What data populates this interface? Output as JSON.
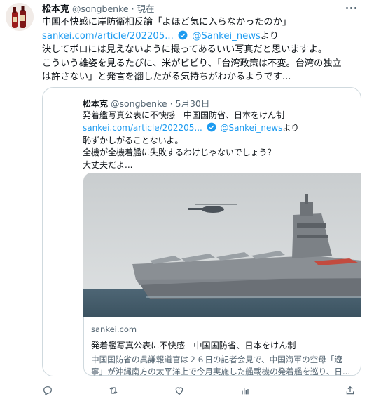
{
  "tweet": {
    "author_name": "松本克",
    "author_handle": "@songbenke",
    "time": "· 現在",
    "lines": [
      "中国不快感に岸防衛相反論「よほど気に入らなかったのか」",
      "決してボロには見えないように撮ってあるいい写真だと思いますよ。",
      "こういう雄姿を見るたびに、米がビビり、「台湾政策は不変。台湾の独立",
      "は許さない」と発言を翻したがる気持ちがわかるようです..."
    ],
    "link_text": "sankei.com/article/202205...",
    "mention": "@Sankei_news",
    "mention_suffix": "より"
  },
  "quote": {
    "author_name": "松本克",
    "author_handle": "@songbenke",
    "time": "· 5月30日",
    "lines": [
      "発着艦写真公表に不快感　中国国防省、日本をけん制",
      "恥ずかしがることないよ。",
      "全機が全機着艦に失敗するわけじゃないでしょう？",
      "大丈夫だよ..."
    ],
    "link_text": "sankei.com/article/202205...",
    "mention": "@Sankei_news",
    "mention_suffix": "より"
  },
  "link_card": {
    "domain": "sankei.com",
    "title": "発着艦写真公表に不快感　中国国防省、日本をけん制",
    "desc_lines": [
      "中国国防省の呉謙報道官は２６日の記者会見で、中国海軍の空母「遼",
      "寧」が沖縄南方の太平洋上で今月実施した艦載機の発着艦を巡り、日..."
    ]
  },
  "icons": [
    "more-icon",
    "verified-icon",
    "reply-icon",
    "retweet-icon",
    "like-icon",
    "analytics-icon",
    "share-icon"
  ],
  "colors": {
    "link": "#1d9bf0",
    "text": "#0f1419",
    "muted": "#536471",
    "border": "#cfd9de"
  }
}
